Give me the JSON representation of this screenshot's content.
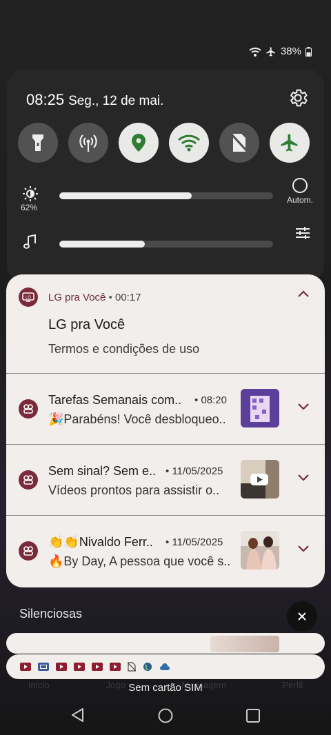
{
  "status_bar": {
    "battery": "38%",
    "icons": [
      "wifi-icon",
      "airplane-icon",
      "battery-icon"
    ]
  },
  "quick_settings": {
    "time": "08:25",
    "date": "Seg., 12 de mai.",
    "tiles": [
      {
        "name": "flashlight",
        "icon": "flashlight-icon",
        "active": false
      },
      {
        "name": "hotspot",
        "icon": "hotspot-icon",
        "active": false
      },
      {
        "name": "location",
        "icon": "location-icon",
        "active": true
      },
      {
        "name": "wifi",
        "icon": "wifi-icon",
        "active": true
      },
      {
        "name": "no-sim",
        "icon": "no-sim-icon",
        "active": false
      },
      {
        "name": "airplane",
        "icon": "airplane-icon",
        "active": true
      }
    ],
    "brightness": {
      "label": "62%",
      "level": 0.62,
      "auto_label": "Autom."
    },
    "volume": {
      "level": 0.4
    }
  },
  "notifications": {
    "expanded": {
      "app": "LG pra Você",
      "separator": "•",
      "time": "00:17",
      "title": "LG pra Você",
      "body": "Termos e condições de uso"
    },
    "items": [
      {
        "title": "Tarefas Semanais com..",
        "sep": "•",
        "time": "08:20",
        "body": "🎉Parabéns! Você desbloqueo.."
      },
      {
        "title": "Sem sinal? Sem e..",
        "sep": "•",
        "time": "11/05/2025",
        "body": "Vídeos prontos para assistir o.."
      },
      {
        "title": "👏👏Nivaldo Ferr..",
        "sep": "•",
        "time": "11/05/2025",
        "body": "🔥By Day, A pessoa que você s.."
      }
    ]
  },
  "silent_section": {
    "label": "Silenciosas"
  },
  "sim_status": "Sem cartão SIM",
  "background_nav": [
    "Início",
    "Jogo",
    "Mensagem",
    "Perfil"
  ],
  "colors": {
    "accent": "#7c2a3a",
    "tile_on": "#e9e9e7",
    "tile_on_icon": "#2e7d32",
    "card_bg": "#f1eeeb"
  }
}
